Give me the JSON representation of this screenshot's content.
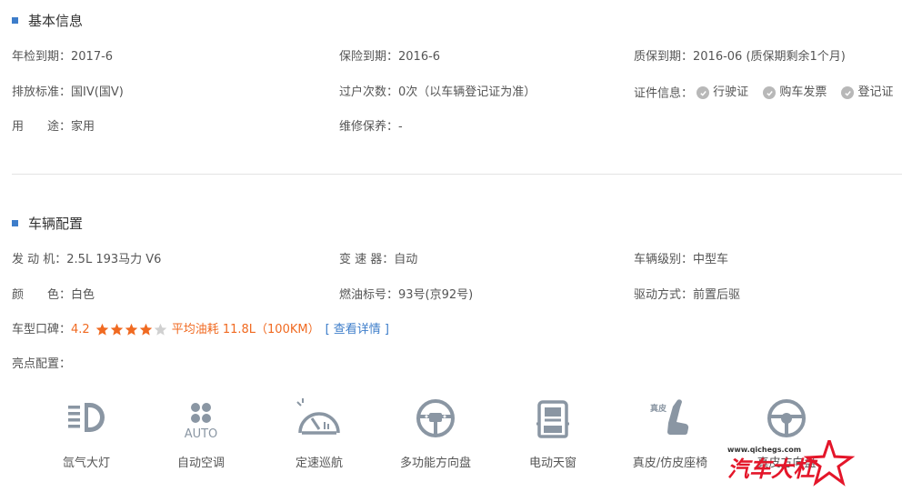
{
  "basic": {
    "title": "基本信息",
    "rows": [
      [
        {
          "label": "年检到期：",
          "value": "2017-6"
        },
        {
          "label": "保险到期：",
          "value": "2016-6"
        },
        {
          "label": "质保到期：",
          "value": "2016-06 (质保期剩余1个月)"
        }
      ],
      [
        {
          "label": "排放标准：",
          "value": "国IV(国V)"
        },
        {
          "label": "过户次数：",
          "value": "0次（以车辆登记证为准）"
        },
        {
          "label": "证件信息：",
          "value": ""
        }
      ],
      [
        {
          "label": "用　　途：",
          "value": "家用"
        },
        {
          "label": "维修保养：",
          "value": "-"
        }
      ]
    ],
    "certs": [
      "行驶证",
      "购车发票",
      "登记证"
    ]
  },
  "config": {
    "title": "车辆配置",
    "rows": [
      [
        {
          "label": "发 动 机：",
          "value": "2.5L 193马力 V6"
        },
        {
          "label": "变 速 器：",
          "value": "自动"
        },
        {
          "label": "车辆级别：",
          "value": "中型车"
        }
      ],
      [
        {
          "label": "颜　　色：",
          "value": "白色"
        },
        {
          "label": "燃油标号：",
          "value": "93号(京92号)"
        },
        {
          "label": "驱动方式：",
          "value": "前置后驱"
        }
      ]
    ],
    "rating": {
      "label": "车型口碑：",
      "score": "4.2",
      "stars_filled": 4,
      "stars_total": 5,
      "fuel": "平均油耗 11.8L（100KM）",
      "detail": "[ 查看详情 ]"
    },
    "highlights_label": "亮点配置：",
    "features": [
      {
        "name": "氙气大灯",
        "icon": "headlight-icon"
      },
      {
        "name": "自动空调",
        "icon": "auto-ac-icon",
        "icon_text": "AUTO"
      },
      {
        "name": "定速巡航",
        "icon": "cruise-control-icon"
      },
      {
        "name": "多功能方向盘",
        "icon": "multifunction-wheel-icon"
      },
      {
        "name": "电动天窗",
        "icon": "sunroof-icon"
      },
      {
        "name": "真皮/仿皮座椅",
        "icon": "leather-seat-icon",
        "icon_text": "真皮"
      },
      {
        "name": "真皮方向盘",
        "icon": "steering-wheel-icon"
      }
    ]
  },
  "colors": {
    "accent": "#3d7dca",
    "rating": "#f06a21",
    "icon": "#8a96a3",
    "check": "#b8b8b8"
  },
  "watermark": {
    "url": "www.qichegs.com",
    "logo_text": "汽车大杠"
  }
}
